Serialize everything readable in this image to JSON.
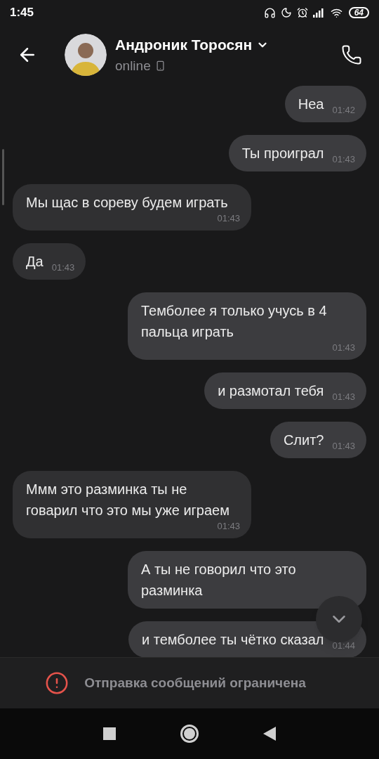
{
  "status_bar": {
    "time": "1:45",
    "battery": "64"
  },
  "header": {
    "name": "Андроник Торосян",
    "status": "online"
  },
  "messages": [
    {
      "text": "Неа",
      "time": "01:42",
      "outgoing": true
    },
    {
      "text": "Ты проиграл",
      "time": "01:43",
      "outgoing": true
    },
    {
      "text": "Мы щас в сореву будем играть",
      "time": "01:43",
      "outgoing": false
    },
    {
      "text": "Да",
      "time": "01:43",
      "outgoing": false
    },
    {
      "text": "Темболее я только учусь в 4 пальца играть",
      "time": "01:43",
      "outgoing": true
    },
    {
      "text": "и размотал тебя",
      "time": "01:43",
      "outgoing": true
    },
    {
      "text": "Слит?",
      "time": "01:43",
      "outgoing": true
    },
    {
      "text": "Ммм это разминка ты не говарил что это мы уже играем",
      "time": "01:43",
      "outgoing": false
    },
    {
      "text": "А ты не говорил что это разминка",
      "outgoing": true
    },
    {
      "text": "и темболее ты чётко сказал",
      "time": "01:44",
      "outgoing": true
    }
  ],
  "notice": "Отправка сообщений ограничена"
}
